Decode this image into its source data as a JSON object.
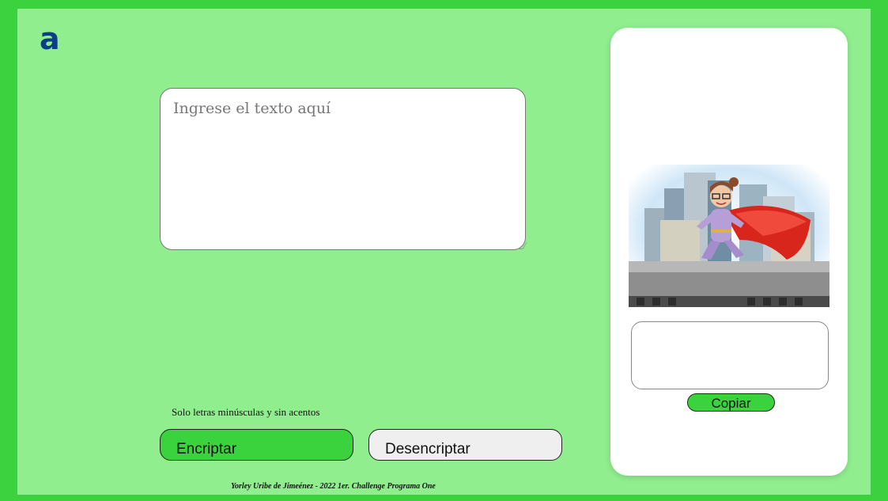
{
  "logo": {
    "glyph": "a",
    "icon": "alura-logo-icon",
    "color": "#0a3f86"
  },
  "input": {
    "placeholder": "Ingrese el texto aquí",
    "value": ""
  },
  "hint": "Solo letras minúsculas y sin acentos",
  "buttons": {
    "encrypt": "Encriptar",
    "decrypt": "Desencriptar",
    "copy": "Copiar"
  },
  "output": {
    "value": ""
  },
  "hero_image": {
    "icon": "superhero-illustration"
  },
  "footer": "Yorley Uribe de Jimeénez - 2022 1er. Challenge Programa One",
  "colors": {
    "background": "#90ee8f",
    "frame": "#3bd13f",
    "accent": "#3ad33e"
  }
}
